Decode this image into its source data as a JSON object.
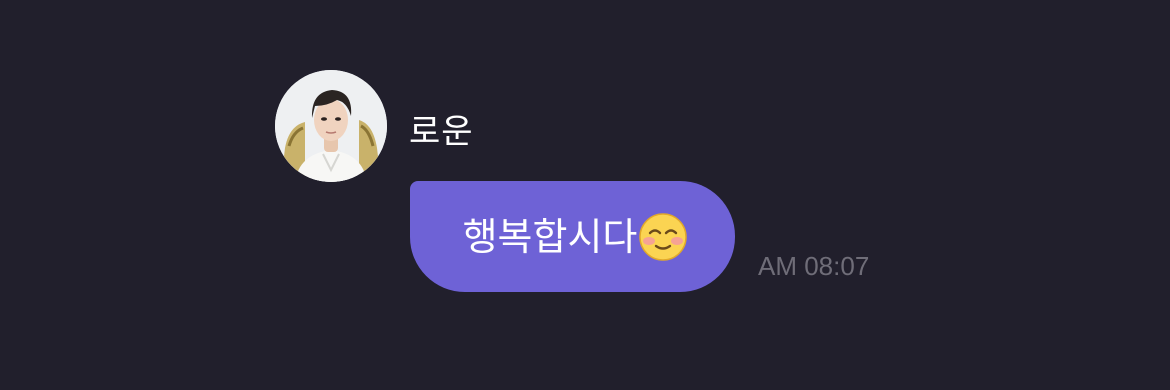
{
  "chat": {
    "sender": {
      "name": "로운",
      "avatar_icon": "profile-photo"
    },
    "message": {
      "text": "행복합시다",
      "emoji": "smiling-face-with-blush-emoji",
      "time": "AM 08:07"
    }
  },
  "colors": {
    "background": "#211f2c",
    "bubble": "#6e62d6",
    "bubble_text": "#ffffff",
    "name_text": "#ffffff",
    "time_text": "#6f6d78"
  }
}
